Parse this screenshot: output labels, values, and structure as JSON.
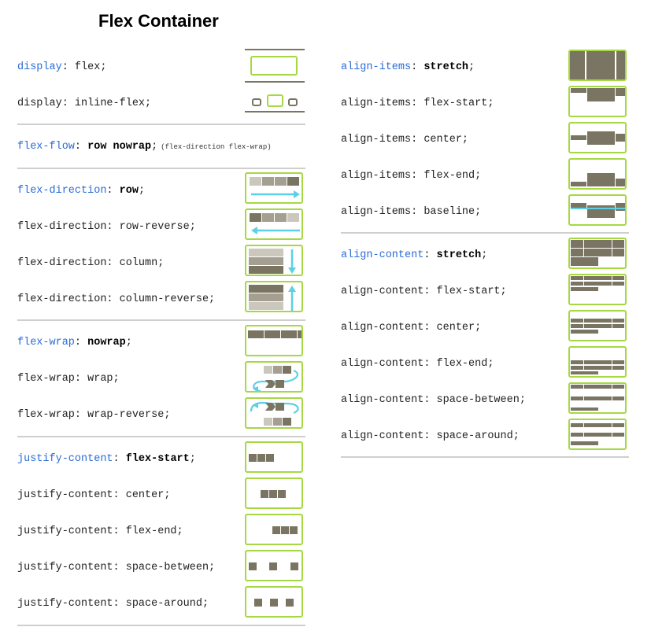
{
  "title": "Flex Container",
  "colors": {
    "accent_green": "#a6d843",
    "prop_blue": "#2b6cd6",
    "item_dark": "#7a7562",
    "item_mid": "#a49f90",
    "item_light": "#cbc7bc",
    "arrow_cyan": "#5ecfe6"
  },
  "left": {
    "display_flex": {
      "prop": "display",
      "rest": ": flex;"
    },
    "display_inline": {
      "text": "display: inline-flex;"
    },
    "flex_flow": {
      "prop": "flex-flow",
      "sep": ": ",
      "value": "row nowrap",
      "semi": ";",
      "note": "(flex-direction flex-wrap)"
    },
    "flex_direction": {
      "prop": "flex-direction",
      "sep": ": ",
      "value": "row",
      "semi": ";",
      "items": [
        "flex-direction: row-reverse;",
        "flex-direction: column;",
        "flex-direction: column-reverse;"
      ]
    },
    "flex_wrap": {
      "prop": "flex-wrap",
      "sep": ": ",
      "value": "nowrap",
      "semi": ";",
      "items": [
        "flex-wrap: wrap;",
        "flex-wrap: wrap-reverse;"
      ]
    },
    "justify_content": {
      "prop": "justify-content",
      "sep": ": ",
      "value": "flex-start",
      "semi": ";",
      "items": [
        "justify-content: center;",
        "justify-content: flex-end;",
        "justify-content: space-between;",
        "justify-content: space-around;"
      ]
    }
  },
  "right": {
    "align_items": {
      "prop": "align-items",
      "sep": ": ",
      "value": "stretch",
      "semi": ";",
      "items": [
        "align-items: flex-start;",
        "align-items: center;",
        "align-items: flex-end;",
        "align-items: baseline;"
      ]
    },
    "align_content": {
      "prop": "align-content",
      "sep": ": ",
      "value": "stretch",
      "semi": ";",
      "items": [
        "align-content: flex-start;",
        "align-content: center;",
        "align-content: flex-end;",
        "align-content: space-between;",
        "align-content: space-around;"
      ]
    }
  }
}
